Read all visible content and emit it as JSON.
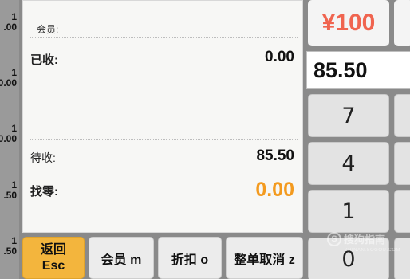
{
  "price_strip": {
    "items": [
      {
        "qty": "1",
        "price": ".00"
      },
      {
        "qty": "1",
        "price": "0.00"
      },
      {
        "qty": "1",
        "price": "0.00"
      },
      {
        "qty": "1",
        "price": ".50"
      },
      {
        "qty": "1",
        "price": ".50"
      }
    ]
  },
  "receipt": {
    "member_label": "会员:",
    "received_label": "已收:",
    "received_value": "0.00",
    "due_label": "待收:",
    "due_value": "85.50",
    "change_label": "找零:",
    "change_value": "0.00"
  },
  "functions": {
    "back_label": "返回",
    "back_key": "Esc",
    "member_button": "会员 m",
    "discount_button": "折扣 o",
    "cancel_order_button": "整单取消 z"
  },
  "payment": {
    "quick_cash_label": "¥100",
    "amount_value": "85.50"
  },
  "keypad": {
    "keys": [
      "7",
      "4",
      "1",
      "0"
    ]
  },
  "watermark": {
    "text": "搜狗指南",
    "sub": "ZHINAN.SOGOU.COM"
  },
  "colors": {
    "accent_orange": "#f39a1e",
    "esc_button": "#f3b53d",
    "quick_cash_text": "#f0644f"
  }
}
